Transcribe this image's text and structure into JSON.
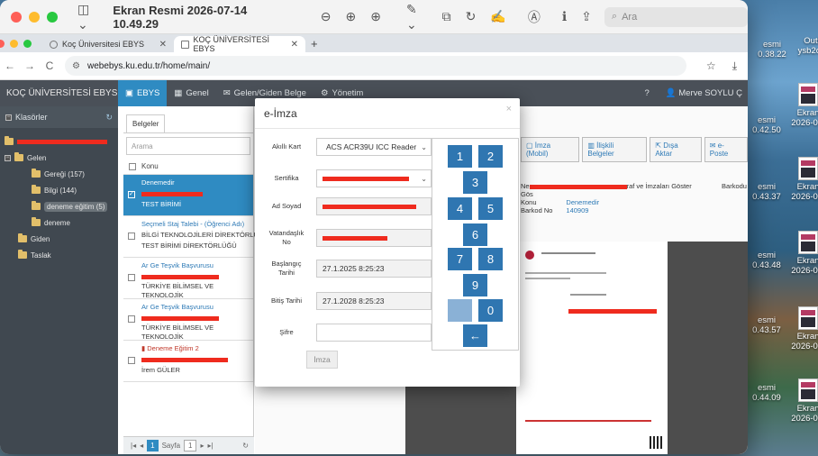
{
  "preview_app": {
    "title": "Ekran Resmi 2026-07-14 10.49.29",
    "search_placeholder": "Ara"
  },
  "browser": {
    "tabs": [
      {
        "label": "Koç Üniversitesi EBYS"
      },
      {
        "label": "KOÇ ÜNİVERSİTESİ EBYS"
      }
    ],
    "url": "webebys.ku.edu.tr/home/main/"
  },
  "app": {
    "brand": "KOÇ ÜNİVERSİTESİ EBYS",
    "menus": [
      "EBYS",
      "Genel",
      "Gelen/Giden Belge",
      "Yönetim"
    ],
    "help": "?",
    "user": "Merve SOYLU Ç"
  },
  "sidebar": {
    "title": "Klasörler",
    "items": [
      "Gelen",
      "Gereği (157)",
      "Bilgi (144)",
      "deneme eğitim (5)",
      "deneme",
      "Giden",
      "Taslak"
    ]
  },
  "list": {
    "tab": "Belgeler",
    "search_placeholder": "Arama",
    "col_header": "Konu",
    "rows": [
      {
        "title": "Denemedir",
        "line2": "",
        "line3": "TEST BİRİMİ"
      },
      {
        "title": "Seçmeli Staj Talebi - (Öğrenci Adı)",
        "line2": "BİLGİ TEKNOLOJİLERİ DİREKTÖRLÜĞÜ",
        "line3": "TEST BİRİMİ DİREKTÖRLÜĞÜ"
      },
      {
        "title": "Ar Ge Teşvik Başvurusu",
        "line2": "TÜRKİYE BİLİMSEL VE TEKNOLOJİK",
        "line3": "ARAŞTIRMA KURUMU..."
      },
      {
        "title": "Ar Ge Teşvik Başvurusu",
        "line2": "TÜRKİYE BİLİMSEL VE TEKNOLOJİK",
        "line3": "ARAŞTIRMA KURUMU..."
      },
      {
        "title": "Deneme Eğitim 2",
        "line2": "",
        "line3": "İrem GÜLER"
      }
    ],
    "pager": {
      "page_label": "Sayfa",
      "page": "1",
      "current": "1"
    }
  },
  "detail": {
    "buttons": [
      "İmza (Mobil)",
      "İlişkili Belgeler",
      "Dışa Aktar",
      "e-Poste"
    ],
    "meta_header": "Ne",
    "meta_header_tail": "raf ve İmzaları Göster",
    "barkod_right": "Barkodu Gös",
    "konu_key": "Konu",
    "konu_val": "Denemedir",
    "barkod_key": "Barkod No",
    "barkod_val": "140909"
  },
  "modal": {
    "title": "e-İmza",
    "close": "×",
    "fields": [
      {
        "label": "Akıllı Kart",
        "value": "ACS ACR39U ICC Reader"
      },
      {
        "label": "Sertifika",
        "value": ""
      },
      {
        "label": "Ad Soyad",
        "value": ""
      },
      {
        "label": "Vatandaşlık No",
        "value": ""
      },
      {
        "label": "Başlangıç Tarihi",
        "value": "27.1.2025 8:25:23"
      },
      {
        "label": "Bitiş Tarihi",
        "value": "27.1.2028 8:25:23"
      },
      {
        "label": "Şifre",
        "value": ""
      }
    ],
    "sign_button": "İmza",
    "keys": [
      "1",
      "2",
      "3",
      "4",
      "5",
      "6",
      "7",
      "8",
      "9",
      "",
      "0",
      "←"
    ]
  },
  "desktop": {
    "icons": [
      "esmi\n0.38.22",
      "Outl\nysb2oa",
      "Ekran\n2026-0...",
      "esmi\n0.42.50",
      "Ekran\n2026-0...",
      "esmi\n0.43.37",
      "esmi\n0.43.48",
      "Ekran\n2026-0...",
      "esmi\n0.43.57",
      "Ekran\n2026-0...",
      "esmi\n0.44.09",
      "Ekran\n2026-0..."
    ]
  }
}
